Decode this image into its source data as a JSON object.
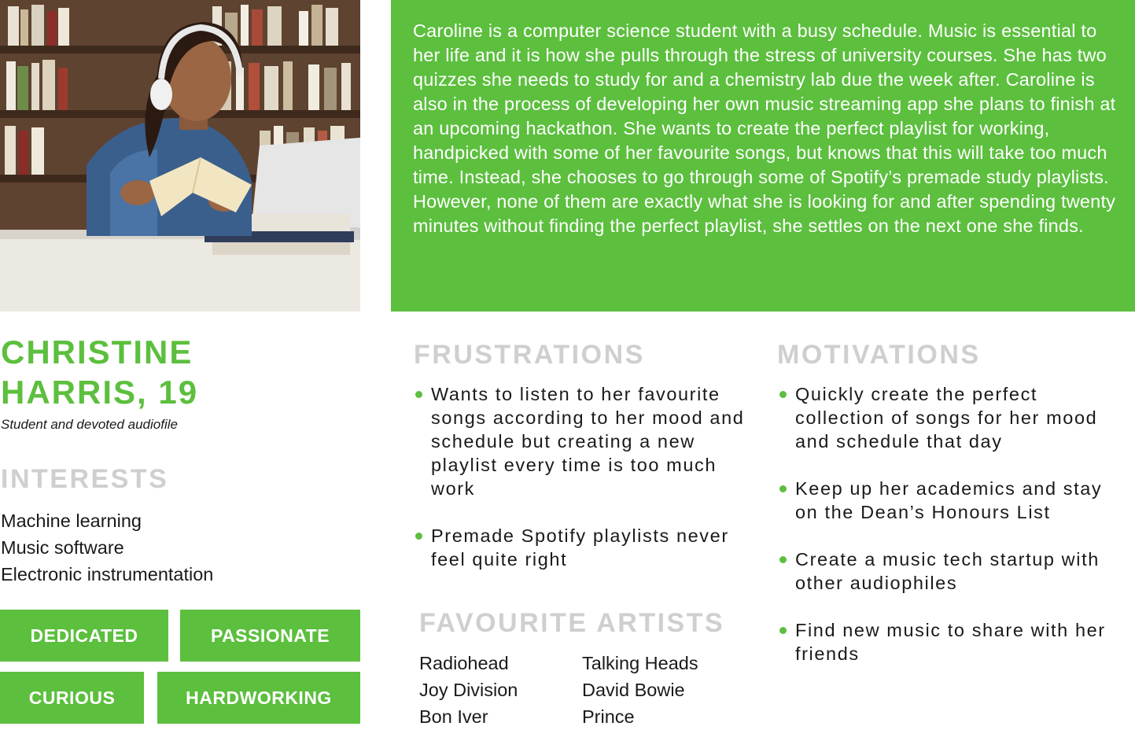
{
  "bio": "Caroline is a computer science student with a busy schedule. Music is essential to her life and it is how she pulls through the stress of university courses. She has two quizzes she needs to study for and a chemistry lab due the week after. Caroline is also in the process of developing her own music streaming app she plans to finish at an upcoming hackathon. She wants to create the perfect playlist for working, handpicked with some of her favourite songs, but knows that this will take too much time. Instead, she chooses to go through some of Spotify’s premade study playlists. However, none of them are exactly what she is looking for and after spending twenty minutes without finding the perfect playlist, she settles on the next one she finds.",
  "persona": {
    "name_line1": "CHRISTINE",
    "name_line2": "HARRIS, 19",
    "tagline": "Student and devoted audiofile"
  },
  "interests": {
    "heading": "INTERESTS",
    "items": [
      "Machine learning",
      "Music software",
      "Electronic instrumentation"
    ]
  },
  "traits": [
    "DEDICATED",
    "PASSIONATE",
    "CURIOUS",
    "HARDWORKING"
  ],
  "frustrations": {
    "heading": "FRUSTRATIONS",
    "items": [
      "Wants to listen to her favourite songs according to her mood and schedule but creating a new playlist every time is too much work",
      "Premade Spotify playlists never feel quite right"
    ]
  },
  "motivations": {
    "heading": "MOTIVATIONS",
    "items": [
      "Quickly create the perfect collection of songs for her mood and schedule that day",
      "Keep up her academics and stay on the Dean’s Honours List",
      "Create a music tech startup with other audiophiles",
      "Find new music to share with her friends"
    ]
  },
  "artists": {
    "heading": "FAVOURITE ARTISTS",
    "col1": [
      "Radiohead",
      "Joy Division",
      "Bon Iver"
    ],
    "col2": [
      "Talking Heads",
      "David Bowie",
      "Prince"
    ]
  },
  "colors": {
    "accent": "#5cbf3e",
    "heading_gray": "#cfcfcf"
  }
}
